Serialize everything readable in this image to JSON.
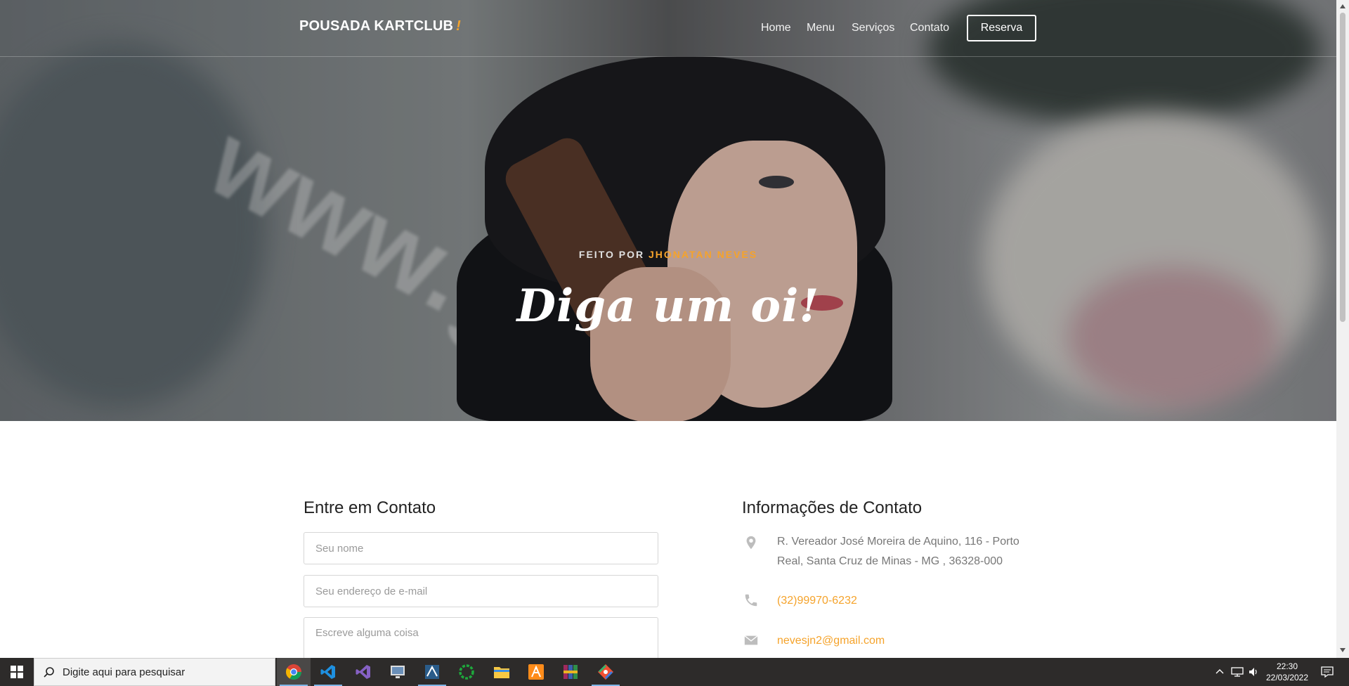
{
  "header": {
    "brand": "POUSADA KARTCLUB",
    "brand_mark": "!",
    "nav": [
      "Home",
      "Menu",
      "Serviços",
      "Contato"
    ],
    "cta": "Reserva"
  },
  "hero": {
    "caption_prefix": "FEITO POR",
    "caption_author": "JHONATAN NEVES",
    "title": "Diga um oi!"
  },
  "contact_form": {
    "title": "Entre em Contato",
    "name_placeholder": "Seu nome",
    "email_placeholder": "Seu endereço de e-mail",
    "message_placeholder": "Escreve alguma coisa"
  },
  "contact_info": {
    "title": "Informações de Contato",
    "address_line1": "R. Vereador José Moreira de Aquino, 116 - Porto",
    "address_line2": "Real, Santa Cruz de Minas - MG , 36328-000",
    "phone": "(32)99970-6232",
    "email": "nevesjn2@gmail.com",
    "icons": [
      "map-pin-icon",
      "phone-icon",
      "envelope-icon"
    ]
  },
  "taskbar": {
    "search_placeholder": "Digite aqui para pesquisar",
    "apps": [
      "chrome-icon",
      "vscode-icon",
      "visual-studio-icon",
      "remote-desktop-icon",
      "sql-tool-icon",
      "progress-ring-icon",
      "file-explorer-icon",
      "sublime-icon",
      "winrar-icon",
      "git-icon"
    ],
    "time": "22:30",
    "date": "22/03/2022"
  },
  "colors": {
    "accent": "#f5a32b",
    "taskbar": "#2d2b2a"
  }
}
